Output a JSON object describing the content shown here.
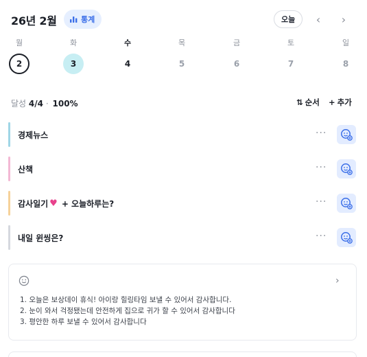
{
  "header": {
    "title": "26년 2월",
    "stats_label": "통계",
    "today_label": "오늘",
    "prev_icon": "chevron-left-icon",
    "next_icon": "chevron-right-icon"
  },
  "week": [
    {
      "name": "월",
      "num": "2",
      "state": "selected"
    },
    {
      "name": "화",
      "num": "3",
      "state": "highlighted"
    },
    {
      "name": "수",
      "num": "4",
      "state": "current"
    },
    {
      "name": "목",
      "num": "5",
      "state": "normal"
    },
    {
      "name": "금",
      "num": "6",
      "state": "normal"
    },
    {
      "name": "토",
      "num": "7",
      "state": "normal"
    },
    {
      "name": "일",
      "num": "8",
      "state": "normal"
    }
  ],
  "summary": {
    "label": "달성",
    "count": "4/4",
    "separator": "·",
    "percent": "100%",
    "sort_label": "순서",
    "add_label": "추가"
  },
  "tasks": [
    {
      "name": "경제뉴스",
      "color": "#9fd6e6"
    },
    {
      "name": "산책",
      "color": "#f3b8d4"
    },
    {
      "name": "감사일기",
      "suffix": "+ 오늘하루는?",
      "color": "#f6d19a"
    },
    {
      "name": "내일 윈씽은?",
      "color": "#d5d8de"
    }
  ],
  "task_more": "···",
  "memo": {
    "lines": [
      "1. 오늘은 보상데이 휴식! 아이랑 힐링타임 보낼 수 있어서 감사합니다.",
      "2. 눈이 와서 걱정됐는데 안전하게 집으로 귀가 할 수 있어서 감사합니다",
      "3. 평안한 하루 보낼 수 있어서 감사합니다"
    ]
  },
  "colors": {
    "accent": "#3a6ee8",
    "selected_day_highlight": "#c7eef3",
    "emoji_button_bg": "#e3ecff"
  }
}
